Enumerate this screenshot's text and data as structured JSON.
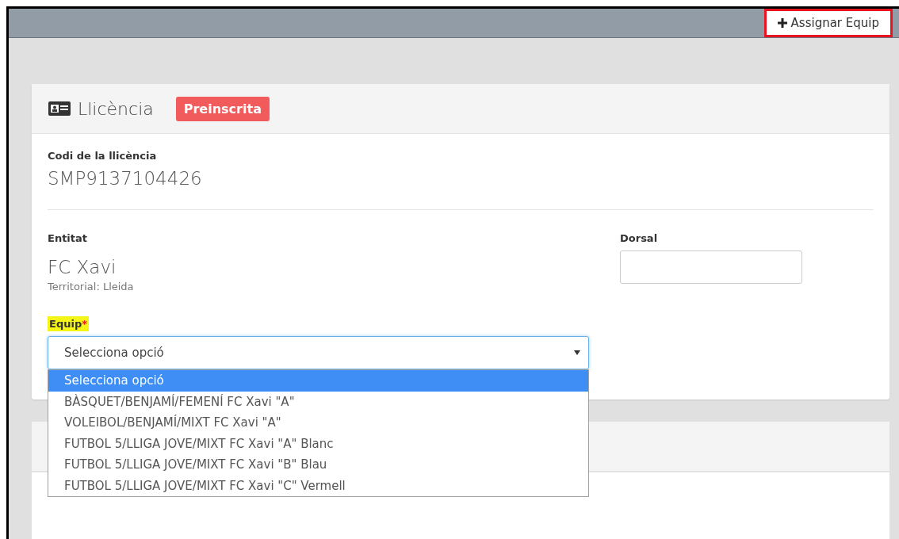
{
  "toolbar": {
    "button": {
      "label": "Assignar Equip",
      "outlined": true
    }
  },
  "license_card": {
    "title": "Llicència",
    "status": "Preinscrita",
    "code": {
      "label": "Codi de la llicència",
      "value": "SMP9137104426"
    },
    "entity": {
      "label": "Entitat",
      "name": "FC Xavi",
      "territorial": "Territorial: Lleida"
    },
    "dorsal": {
      "label": "Dorsal"
    },
    "team": {
      "label": "Equip",
      "required_mark": "*",
      "highlighted": true,
      "value": "Selecciona opció",
      "expanded": true,
      "options": [
        {
          "label": "Selecciona opció",
          "selected": true
        },
        {
          "label": "BÀSQUET/BENJAMÍ/FEMENÍ FC Xavi \"A\"",
          "selected": false
        },
        {
          "label": "VOLEIBOL/BENJAMÍ/MIXT FC Xavi \"A\"",
          "selected": false
        },
        {
          "label": "FUTBOL 5/LLIGA JOVE/MIXT FC Xavi \"A\" Blanc",
          "selected": false
        },
        {
          "label": "FUTBOL 5/LLIGA JOVE/MIXT FC Xavi \"B\" Blau",
          "selected": false
        },
        {
          "label": "FUTBOL 5/LLIGA JOVE/MIXT FC Xavi \"C\" Vermell",
          "selected": false
        }
      ]
    }
  }
}
